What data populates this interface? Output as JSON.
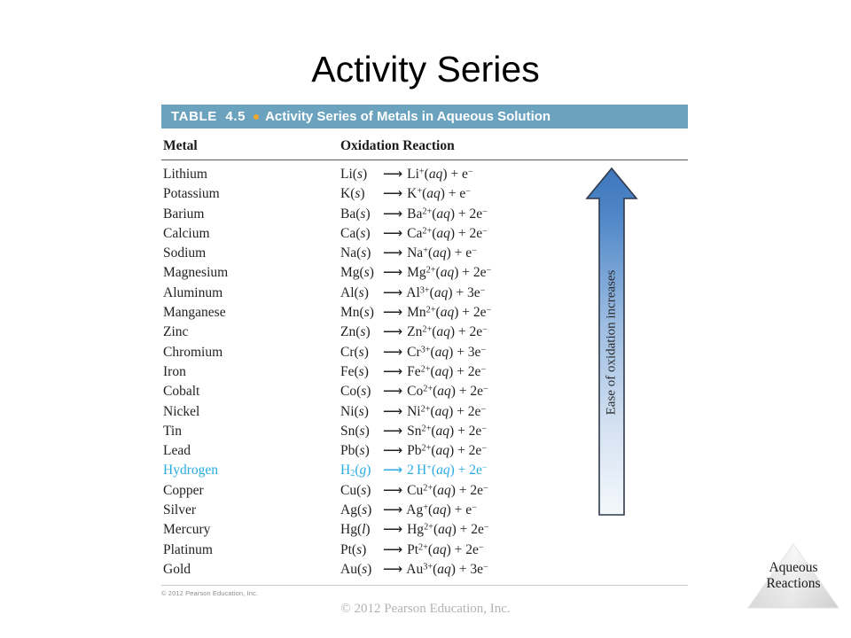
{
  "slide": {
    "title": "Activity Series",
    "footer": "© 2012 Pearson Education, Inc."
  },
  "table": {
    "label": "TABLE  4.5",
    "bullet_color": "#f0a732",
    "header_bg": "#6ba2be",
    "title": "Activity Series of Metals in Aqueous Solution",
    "credit": "© 2012 Pearson Education, Inc.",
    "columns": [
      "Metal",
      "Oxidation Reaction"
    ],
    "highlight_color": "#29abe2",
    "rows": [
      {
        "metal": "Lithium",
        "reactant": "Li",
        "reactant_state": "s",
        "ion": "Li",
        "charge": "+",
        "electrons": "e",
        "electron_coeff": "",
        "product_coeff": "",
        "highlight": false
      },
      {
        "metal": "Potassium",
        "reactant": "K",
        "reactant_state": "s",
        "ion": "K",
        "charge": "+",
        "electrons": "e",
        "electron_coeff": "",
        "product_coeff": "",
        "highlight": false
      },
      {
        "metal": "Barium",
        "reactant": "Ba",
        "reactant_state": "s",
        "ion": "Ba",
        "charge": "2+",
        "electrons": "e",
        "electron_coeff": "2",
        "product_coeff": "",
        "highlight": false
      },
      {
        "metal": "Calcium",
        "reactant": "Ca",
        "reactant_state": "s",
        "ion": "Ca",
        "charge": "2+",
        "electrons": "e",
        "electron_coeff": "2",
        "product_coeff": "",
        "highlight": false
      },
      {
        "metal": "Sodium",
        "reactant": "Na",
        "reactant_state": "s",
        "ion": "Na",
        "charge": "+",
        "electrons": "e",
        "electron_coeff": "",
        "product_coeff": "",
        "highlight": false
      },
      {
        "metal": "Magnesium",
        "reactant": "Mg",
        "reactant_state": "s",
        "ion": "Mg",
        "charge": "2+",
        "electrons": "e",
        "electron_coeff": "2",
        "product_coeff": "",
        "highlight": false
      },
      {
        "metal": "Aluminum",
        "reactant": "Al",
        "reactant_state": "s",
        "ion": "Al",
        "charge": "3+",
        "electrons": "e",
        "electron_coeff": "3",
        "product_coeff": "",
        "highlight": false
      },
      {
        "metal": "Manganese",
        "reactant": "Mn",
        "reactant_state": "s",
        "ion": "Mn",
        "charge": "2+",
        "electrons": "e",
        "electron_coeff": "2",
        "product_coeff": "",
        "highlight": false
      },
      {
        "metal": "Zinc",
        "reactant": "Zn",
        "reactant_state": "s",
        "ion": "Zn",
        "charge": "2+",
        "electrons": "e",
        "electron_coeff": "2",
        "product_coeff": "",
        "highlight": false
      },
      {
        "metal": "Chromium",
        "reactant": "Cr",
        "reactant_state": "s",
        "ion": "Cr",
        "charge": "3+",
        "electrons": "e",
        "electron_coeff": "3",
        "product_coeff": "",
        "highlight": false
      },
      {
        "metal": "Iron",
        "reactant": "Fe",
        "reactant_state": "s",
        "ion": "Fe",
        "charge": "2+",
        "electrons": "e",
        "electron_coeff": "2",
        "product_coeff": "",
        "highlight": false
      },
      {
        "metal": "Cobalt",
        "reactant": "Co",
        "reactant_state": "s",
        "ion": "Co",
        "charge": "2+",
        "electrons": "e",
        "electron_coeff": "2",
        "product_coeff": "",
        "highlight": false
      },
      {
        "metal": "Nickel",
        "reactant": "Ni",
        "reactant_state": "s",
        "ion": "Ni",
        "charge": "2+",
        "electrons": "e",
        "electron_coeff": "2",
        "product_coeff": "",
        "highlight": false
      },
      {
        "metal": "Tin",
        "reactant": "Sn",
        "reactant_state": "s",
        "ion": "Sn",
        "charge": "2+",
        "electrons": "e",
        "electron_coeff": "2",
        "product_coeff": "",
        "highlight": false
      },
      {
        "metal": "Lead",
        "reactant": "Pb",
        "reactant_state": "s",
        "ion": "Pb",
        "charge": "2+",
        "electrons": "e",
        "electron_coeff": "2",
        "product_coeff": "",
        "highlight": false
      },
      {
        "metal": "Hydrogen",
        "reactant": "H",
        "reactant_sub": "2",
        "reactant_state": "g",
        "ion": "H",
        "charge": "+",
        "electrons": "e",
        "electron_coeff": "2",
        "product_coeff": "2",
        "highlight": true
      },
      {
        "metal": "Copper",
        "reactant": "Cu",
        "reactant_state": "s",
        "ion": "Cu",
        "charge": "2+",
        "electrons": "e",
        "electron_coeff": "2",
        "product_coeff": "",
        "highlight": false
      },
      {
        "metal": "Silver",
        "reactant": "Ag",
        "reactant_state": "s",
        "ion": "Ag",
        "charge": "+",
        "electrons": "e",
        "electron_coeff": "",
        "product_coeff": "",
        "highlight": false
      },
      {
        "metal": "Mercury",
        "reactant": "Hg",
        "reactant_state": "l",
        "ion": "Hg",
        "charge": "2+",
        "electrons": "e",
        "electron_coeff": "2",
        "product_coeff": "",
        "highlight": false
      },
      {
        "metal": "Platinum",
        "reactant": "Pt",
        "reactant_state": "s",
        "ion": "Pt",
        "charge": "2+",
        "electrons": "e",
        "electron_coeff": "2",
        "product_coeff": "",
        "highlight": false
      },
      {
        "metal": "Gold",
        "reactant": "Au",
        "reactant_state": "s",
        "ion": "Au",
        "charge": "3+",
        "electrons": "e",
        "electron_coeff": "3",
        "product_coeff": "",
        "highlight": false
      }
    ],
    "aqueous_state": "aq",
    "electron_charge": "−",
    "arrow_glyph": "⟶"
  },
  "ease_arrow": {
    "label": "Ease of oxidation increases",
    "direction": "up",
    "gradient_top": "#4a7fc1",
    "gradient_bottom": "#f2f6fb",
    "outline": "#2f3a4a"
  },
  "corner_badge": {
    "line1": "Aqueous",
    "line2": "Reactions"
  }
}
